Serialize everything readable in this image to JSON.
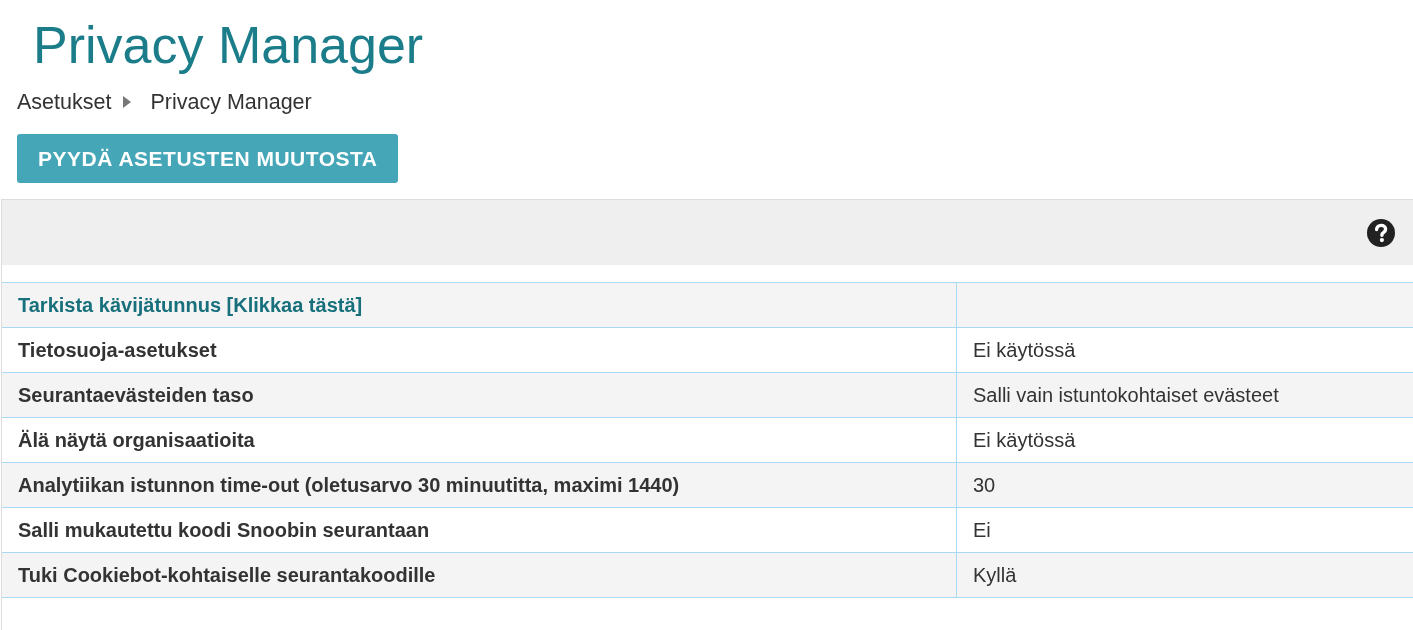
{
  "page": {
    "title": "Privacy Manager"
  },
  "breadcrumb": [
    {
      "label": "Asetukset"
    },
    {
      "label": "Privacy Manager"
    }
  ],
  "actions": [
    {
      "label": "PYYDÄ ASETUSTEN MUUTOSTA"
    }
  ],
  "settings": [
    {
      "kind": "link",
      "label": "Tarkista kävijätunnus [Klikkaa tästä]"
    },
    {
      "kind": "setting",
      "label": "Tietosuoja-asetukset",
      "value": "Ei käytössä"
    },
    {
      "kind": "setting",
      "label": "Seurantaevästeiden taso",
      "value": "Salli vain istuntokohtaiset evästeet"
    },
    {
      "kind": "setting",
      "label": "Älä näytä organisaatioita",
      "value": "Ei käytössä"
    },
    {
      "kind": "setting",
      "label": "Analytiikan istunnon time-out (oletusarvo 30 minuutitta, maximi 1440)",
      "value": "30"
    },
    {
      "kind": "setting",
      "label": "Salli mukautettu koodi Snoobin seurantaan",
      "value": "Ei"
    },
    {
      "kind": "setting",
      "label": "Tuki Cookiebot-kohtaiselle seurantakoodille",
      "value": "Kyllä"
    }
  ]
}
